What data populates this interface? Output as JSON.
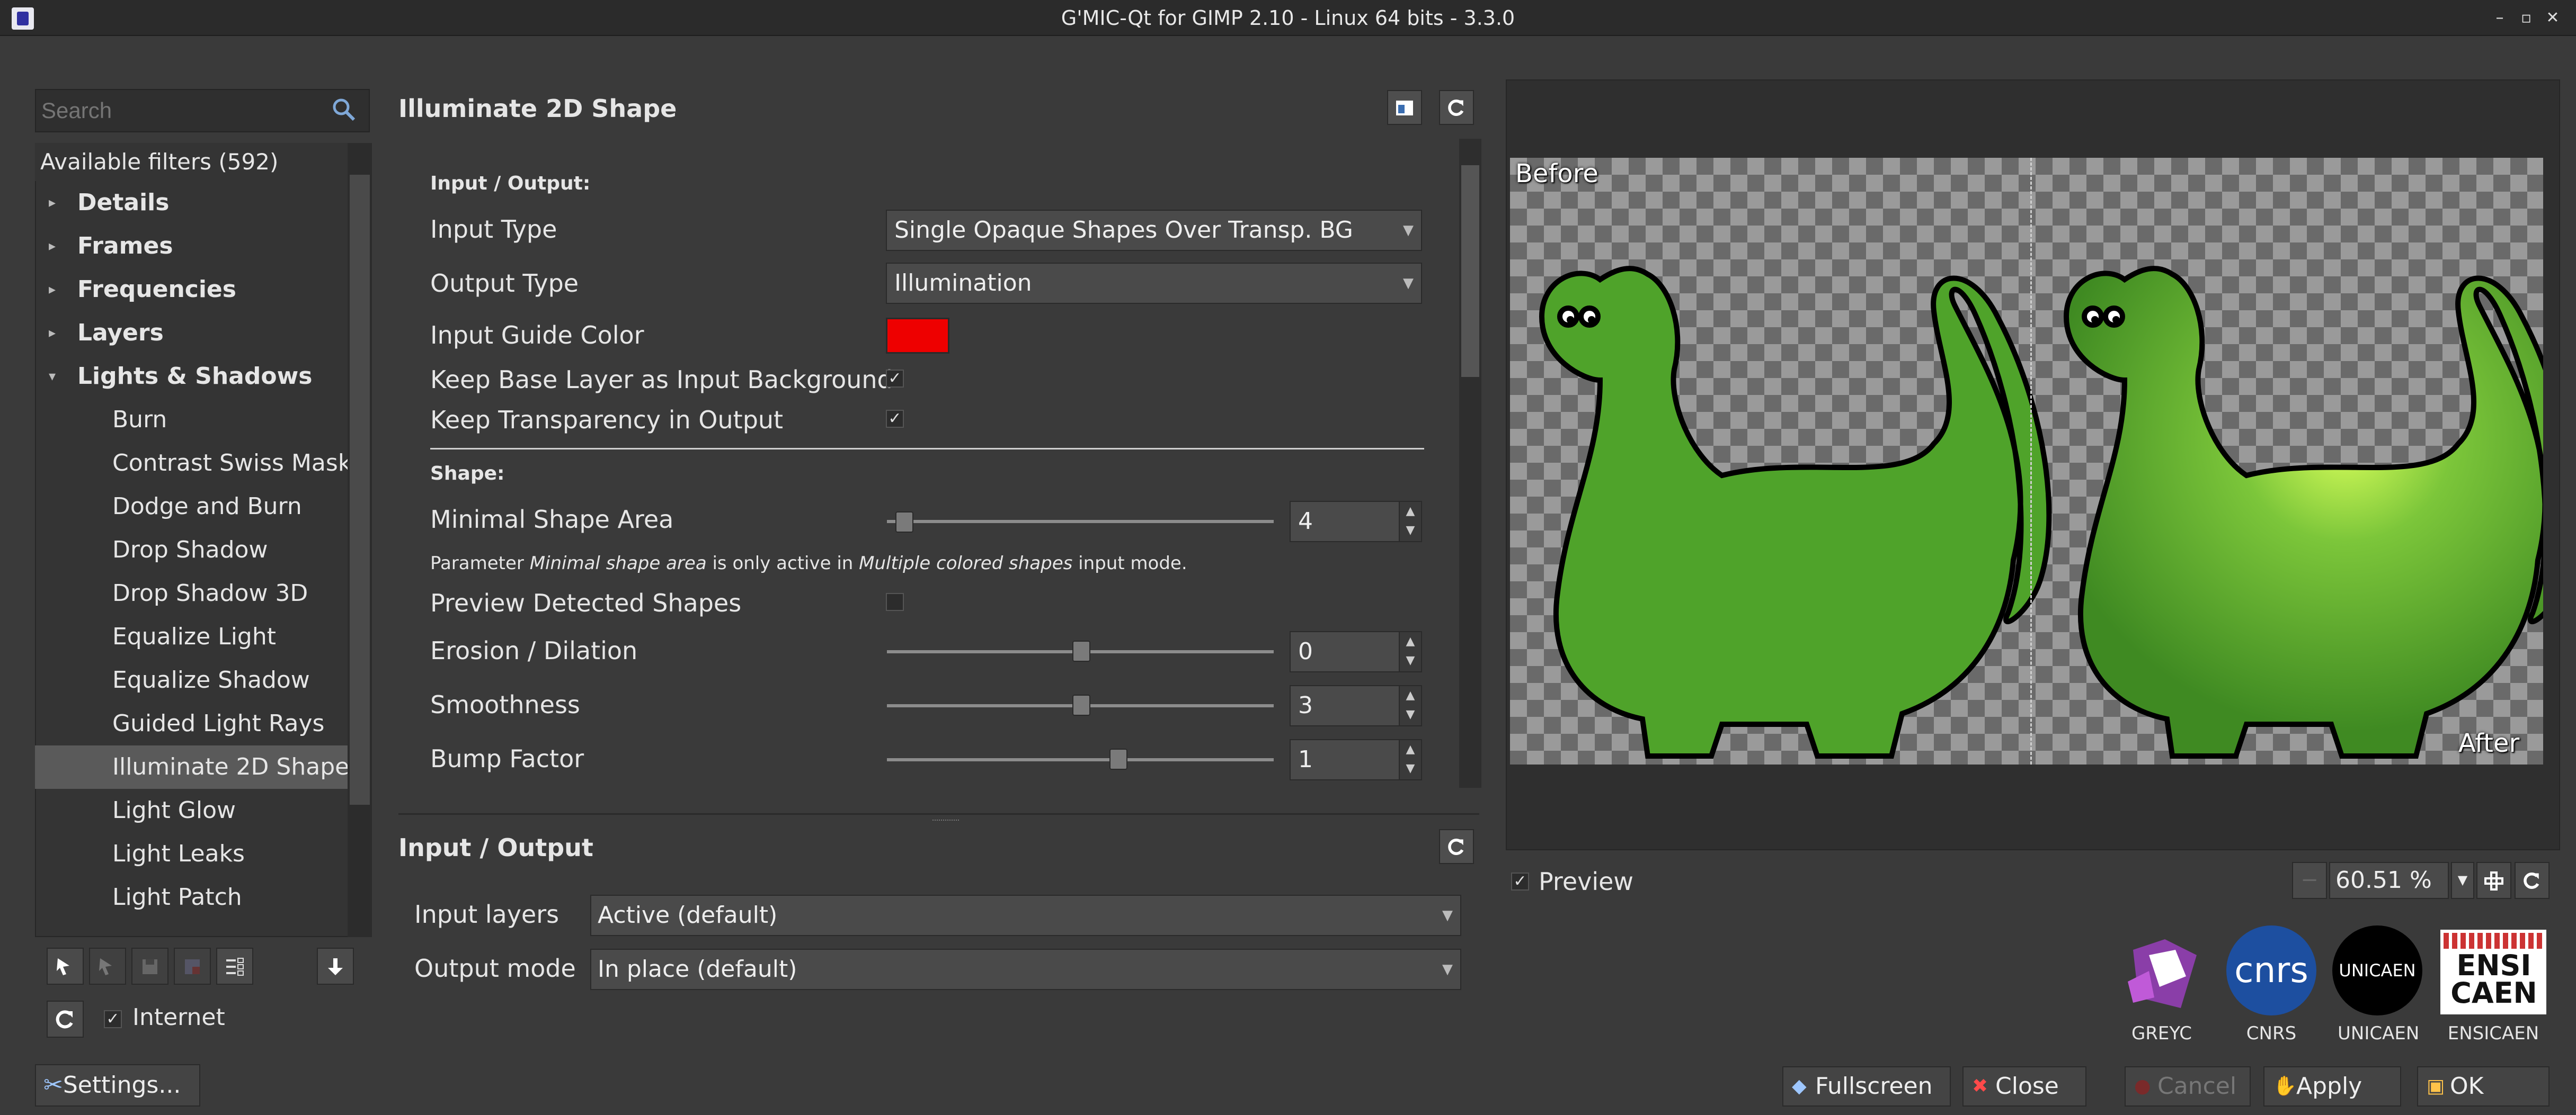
{
  "window": {
    "title": "G'MIC-Qt for GIMP 2.10 - Linux 64 bits - 3.3.0",
    "controls": [
      "–",
      "▫",
      "✕"
    ]
  },
  "left": {
    "search_placeholder": "Search",
    "tree_header": "Available filters (592)",
    "categories": [
      {
        "label": "Details",
        "expanded": false
      },
      {
        "label": "Frames",
        "expanded": false
      },
      {
        "label": "Frequencies",
        "expanded": false
      },
      {
        "label": "Layers",
        "expanded": false
      },
      {
        "label": "Lights & Shadows",
        "expanded": true
      }
    ],
    "filters": [
      "Burn",
      "Contrast Swiss Mask",
      "Dodge and Burn",
      "Drop Shadow",
      "Drop Shadow 3D",
      "Equalize Light",
      "Equalize Shadow",
      "Guided Light Rays",
      "Illuminate 2D Shape",
      "Light Glow",
      "Light Leaks",
      "Light Patch"
    ],
    "selected_filter": "Illuminate 2D Shape",
    "internet_label": "Internet",
    "internet_checked": true,
    "settings_label": "Settings..."
  },
  "filter": {
    "title": "Illuminate 2D Shape",
    "section_io": "Input / Output:",
    "input_type_label": "Input Type",
    "input_type_value": "Single Opaque Shapes Over Transp. BG",
    "output_type_label": "Output Type",
    "output_type_value": "Illumination",
    "guide_color_label": "Input Guide Color",
    "guide_color": "#ee0000",
    "keep_base_label": "Keep Base Layer as Input Background",
    "keep_base_checked": true,
    "keep_transp_label": "Keep Transparency in Output",
    "keep_transp_checked": true,
    "section_shape": "Shape:",
    "min_area_label": "Minimal Shape Area",
    "min_area_value": "4",
    "note_prefix": "Parameter ",
    "note_em1": "Minimal shape area",
    "note_mid": " is only active in ",
    "note_em2": "Multiple colored shapes",
    "note_suffix": " input mode.",
    "preview_shapes_label": "Preview Detected Shapes",
    "preview_shapes_checked": false,
    "erosion_label": "Erosion / Dilation",
    "erosion_value": "0",
    "smoothness_label": "Smoothness",
    "smoothness_value": "3",
    "bump_label": "Bump Factor",
    "bump_value": "1"
  },
  "io": {
    "title": "Input / Output",
    "input_layers_label": "Input layers",
    "input_layers_value": "Active (default)",
    "output_mode_label": "Output mode",
    "output_mode_value": "In place (default)"
  },
  "preview": {
    "before_label": "Before",
    "after_label": "After",
    "checkbox_label": "Preview",
    "checked": true,
    "zoom": "60.51 %"
  },
  "logos": {
    "greyc": "GREYC",
    "cnrs": "CNRS",
    "cnrs_mark": "cnrs",
    "unicaen": "UNICAEN",
    "unicaen_mark": "UNICAEN",
    "ensicaen": "ENSICAEN",
    "ensicaen_mark_1": "ENSI",
    "ensicaen_mark_2": "CAEN"
  },
  "buttons": {
    "fullscreen": "Fullscreen",
    "close": "Close",
    "cancel": "Cancel",
    "apply": "Apply",
    "ok": "OK"
  },
  "colors": {
    "background": "#3a3a3a",
    "accent_red": "#ee0000",
    "dino_green": "#4fa32a"
  }
}
